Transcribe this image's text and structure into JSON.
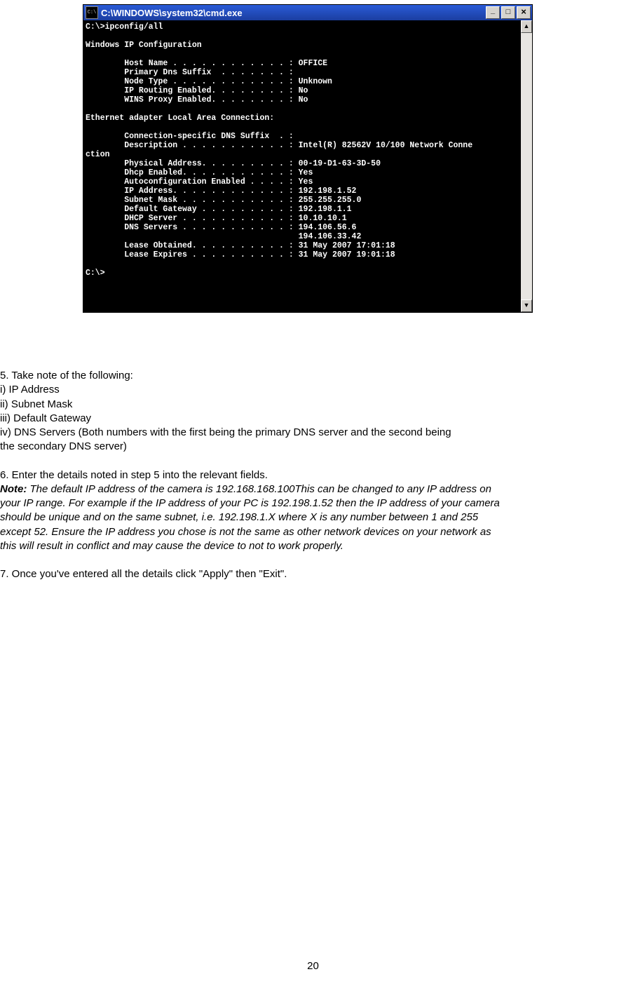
{
  "cmd": {
    "title": "C:\\WINDOWS\\system32\\cmd.exe",
    "lines": {
      "l1": "C:\\>ipconfig/all",
      "l2": "",
      "l3": "Windows IP Configuration",
      "l4": "",
      "l5": "        Host Name . . . . . . . . . . . . : OFFICE",
      "l6": "        Primary Dns Suffix  . . . . . . . :",
      "l7": "        Node Type . . . . . . . . . . . . : Unknown",
      "l8": "        IP Routing Enabled. . . . . . . . : No",
      "l9": "        WINS Proxy Enabled. . . . . . . . : No",
      "l10": "",
      "l11": "Ethernet adapter Local Area Connection:",
      "l12": "",
      "l13": "        Connection-specific DNS Suffix  . :",
      "l14": "        Description . . . . . . . . . . . : Intel(R) 82562V 10/100 Network Conne",
      "l15": "ction",
      "l16": "        Physical Address. . . . . . . . . : 00-19-D1-63-3D-50",
      "l17": "        Dhcp Enabled. . . . . . . . . . . : Yes",
      "l18": "        Autoconfiguration Enabled . . . . : Yes",
      "l19": "        IP Address. . . . . . . . . . . . : 192.198.1.52",
      "l20": "        Subnet Mask . . . . . . . . . . . : 255.255.255.0",
      "l21": "        Default Gateway . . . . . . . . . : 192.198.1.1",
      "l22": "        DHCP Server . . . . . . . . . . . : 10.10.10.1",
      "l23": "        DNS Servers . . . . . . . . . . . : 194.106.56.6",
      "l24": "                                            194.106.33.42",
      "l25": "        Lease Obtained. . . . . . . . . . : 31 May 2007 17:01:18",
      "l26": "        Lease Expires . . . . . . . . . . : 31 May 2007 19:01:18",
      "l27": "",
      "l28": "C:\\>"
    }
  },
  "doc": {
    "step5_head": "5. Take note of the following:",
    "step5_i": "i) IP Address",
    "step5_ii": "ii) Subnet Mask",
    "step5_iii": "iii) Default Gateway",
    "step5_iv_a": "iv) DNS Servers (Both numbers with the first being the primary DNS server and the second being",
    "step5_iv_b": "the secondary DNS server)",
    "step6": "6. Enter the details noted in step 5 into the relevant fields.",
    "note_prefix": "Note:",
    "note_body1": " The default IP address of the camera is 192.168.168.100This can be changed to any IP address on",
    "note_body2": "your IP range. For example if the IP address of your PC is 192.198.1.52 then the IP address of your camera",
    "note_body3": "should be unique and on the same subnet, i.e. 192.198.1.X where X is any number between 1 and 255",
    "note_body4": "except 52. Ensure the IP address you chose is not the same as other network devices on your network as",
    "note_body5": "this will result in conflict and may cause the device to not to work properly.",
    "step7": "7. Once you've entered all the details click \"Apply\" then \"Exit\".",
    "pagenum": "20"
  }
}
